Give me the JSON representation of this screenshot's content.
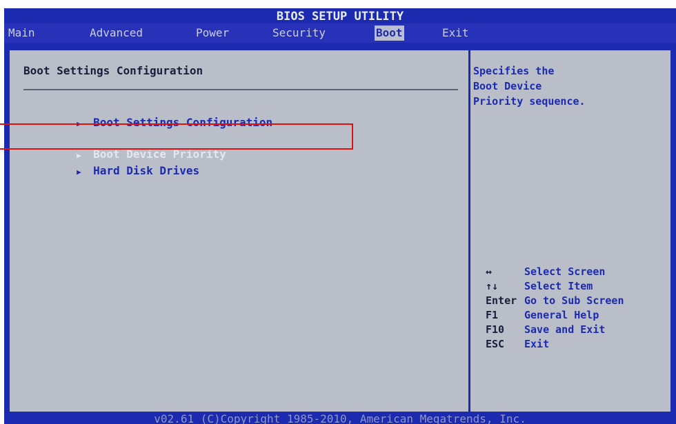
{
  "title": "BIOS SETUP UTILITY",
  "tabs": [
    {
      "label": "Main"
    },
    {
      "label": "Advanced"
    },
    {
      "label": "Power"
    },
    {
      "label": "Security"
    },
    {
      "label": "Boot"
    },
    {
      "label": "Exit"
    }
  ],
  "section_title": "Boot Settings Configuration",
  "items": [
    {
      "label": "Boot Settings Configuration"
    },
    {
      "label": "Boot Device Priority"
    },
    {
      "label": "Hard Disk Drives"
    }
  ],
  "selected_item": "Boot Device Priority",
  "help_text": "Specifies the\nBoot Device\nPriority sequence.",
  "keys": [
    {
      "key": "↔",
      "desc": "Select Screen"
    },
    {
      "key": "↑↓",
      "desc": "Select Item"
    },
    {
      "key": "Enter",
      "desc": "Go to Sub Screen"
    },
    {
      "key": "F1",
      "desc": "General Help"
    },
    {
      "key": "F10",
      "desc": "Save and Exit"
    },
    {
      "key": "ESC",
      "desc": "Exit"
    }
  ],
  "footer": "v02.61 (C)Copyright 1985-2010, American Megatrends, Inc.",
  "colors": {
    "bios_blue": "#1c2ab0",
    "panel_gray": "#b9bec9",
    "highlight_red": "#e01010"
  }
}
